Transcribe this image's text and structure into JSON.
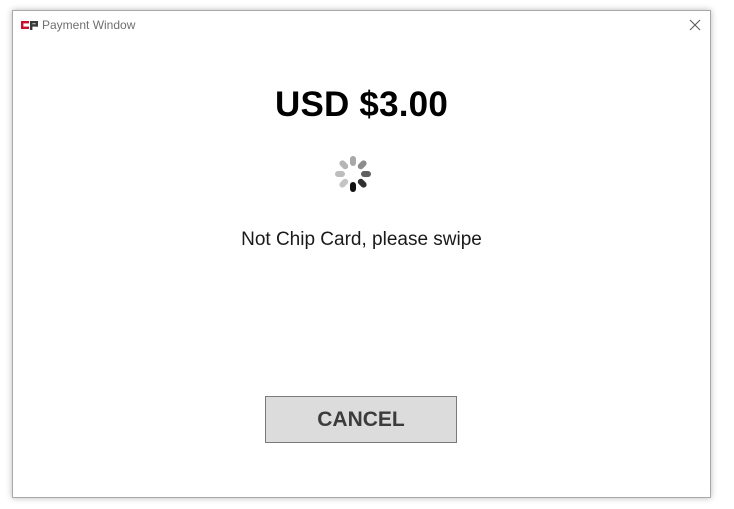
{
  "window": {
    "title": "Payment Window",
    "logo_icon": "payment-logo-icon",
    "close_icon": "close-icon"
  },
  "payment": {
    "amount": "USD $3.00",
    "status_message": "Not Chip Card, please swipe",
    "spinner_icon": "loading-spinner-icon"
  },
  "actions": {
    "cancel_label": "CANCEL"
  },
  "colors": {
    "logo_red": "#c8102e",
    "logo_dark": "#3a3a3a",
    "button_bg": "#dcdcdc",
    "button_border": "#7a7a7a"
  }
}
